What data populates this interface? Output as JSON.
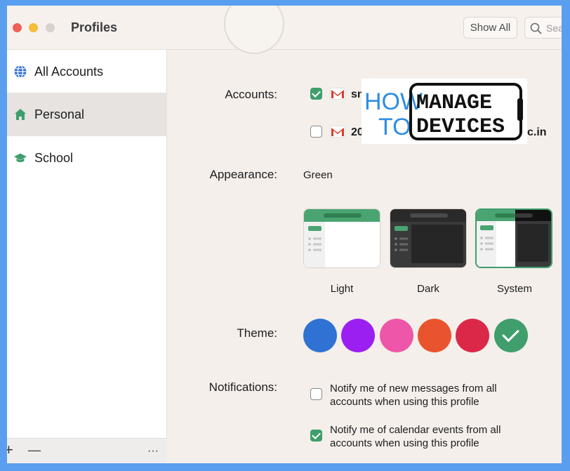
{
  "window": {
    "title": "Profiles"
  },
  "toolbar": {
    "show_all_label": "Show All",
    "search_placeholder": "Sea"
  },
  "sidebar": {
    "items": [
      {
        "label": "All Accounts",
        "icon": "globe-icon",
        "active": false
      },
      {
        "label": "Personal",
        "icon": "home-icon",
        "active": true
      },
      {
        "label": "School",
        "icon": "graduation-cap-icon",
        "active": false
      }
    ],
    "footer": {
      "add_label": "+",
      "remove_label": "—",
      "more_label": "···"
    }
  },
  "main": {
    "accounts": {
      "label": "Accounts:",
      "items": [
        {
          "text": "sn",
          "checked": true,
          "icon": "gmail-icon"
        },
        {
          "text": "20",
          "suffix": "c.in",
          "checked": false,
          "icon": "gmail-icon"
        }
      ]
    },
    "watermark": {
      "line1a": "HOW",
      "line1b": "MANAGE",
      "line2a": "TO",
      "line2b": "DEVICES"
    },
    "appearance": {
      "label": "Appearance:",
      "value": "Green",
      "options": [
        {
          "label": "Light",
          "selected": false
        },
        {
          "label": "Dark",
          "selected": false
        },
        {
          "label": "System",
          "selected": true
        }
      ]
    },
    "theme": {
      "label": "Theme:",
      "swatches": [
        "#2f72d3",
        "#9b1ff0",
        "#ee56a9",
        "#e9542f",
        "#dc2848",
        "#3f9e6c"
      ],
      "selected_index": 5
    },
    "notifications": {
      "label": "Notifications:",
      "items": [
        {
          "line1": "Notify me of new messages from all",
          "line2": "accounts when using this profile",
          "checked": false
        },
        {
          "line1": "Notify me of calendar events from all",
          "line2": "accounts when using this profile",
          "checked": true
        }
      ]
    }
  },
  "colors": {
    "accent": "#3f9e6c",
    "window_bg": "#f4efea",
    "sidebar_bg": "#ffffff",
    "desktop": "#5a9ef0"
  }
}
